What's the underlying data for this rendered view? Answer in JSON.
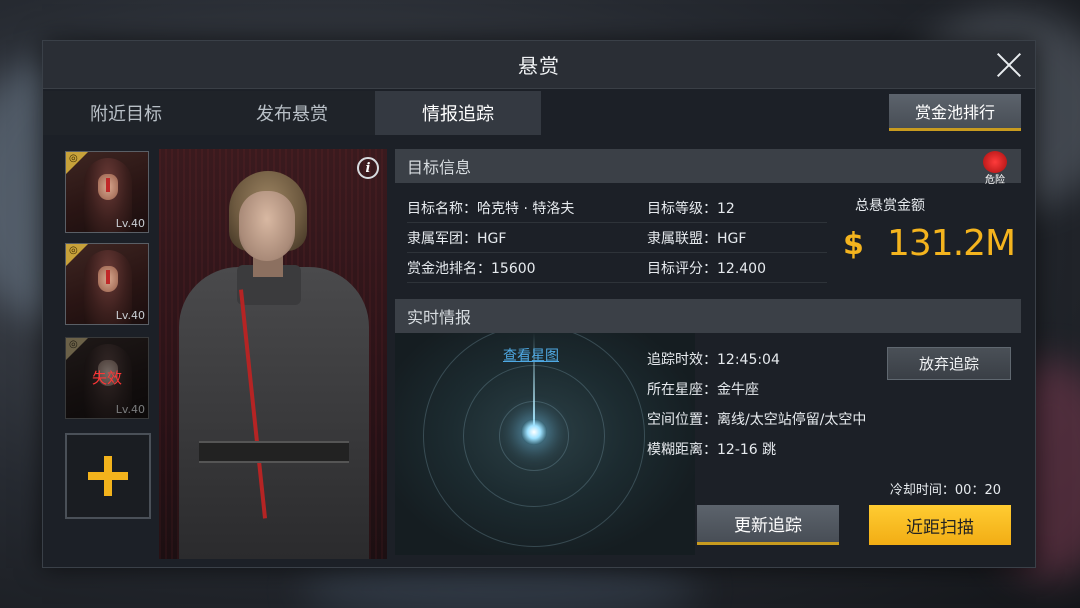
{
  "window": {
    "title": "悬赏"
  },
  "tabs": [
    {
      "label": "附近目标",
      "active": false
    },
    {
      "label": "发布悬赏",
      "active": false
    },
    {
      "label": "情报追踪",
      "active": true
    }
  ],
  "rank_button": "赏金池排行",
  "targets": [
    {
      "level": "Lv.40",
      "status": ""
    },
    {
      "level": "Lv.40",
      "status": ""
    },
    {
      "level": "Lv.40",
      "status": "失效"
    }
  ],
  "target_info": {
    "header": "目标信息",
    "danger_label": "危险",
    "name": "目标名称：哈克特 · 特洛夫",
    "level": "目标等级：12",
    "legion": "隶属军团：HGF",
    "alliance": "隶属联盟：HGF",
    "pool_rank": "赏金池排名：15600",
    "score": "目标评分：12.400",
    "total_bounty_label": "总悬赏金额",
    "currency_symbol": "$",
    "total_bounty_value": "131.2M"
  },
  "live_intel": {
    "header": "实时情报",
    "tracking_time": "追踪时效：12:45:04",
    "constellation": "所在星座：金牛座",
    "location": "空间位置：离线/太空站停留/太空中",
    "distance": "模糊距离：12-16 跳",
    "star_map_link": "查看星图",
    "abandon_button": "放弃追踪",
    "cooldown": "冷却时间：00：20",
    "update_button": "更新追踪",
    "scan_button": "近距扫描"
  },
  "colors": {
    "accent": "#f4b41e",
    "danger": "#d41f1f",
    "link": "#4fa9e3"
  },
  "icons": {
    "close": "close-icon",
    "info": "info-icon",
    "add": "plus-icon",
    "currency": "dollar-icon",
    "danger": "skull-icon"
  }
}
